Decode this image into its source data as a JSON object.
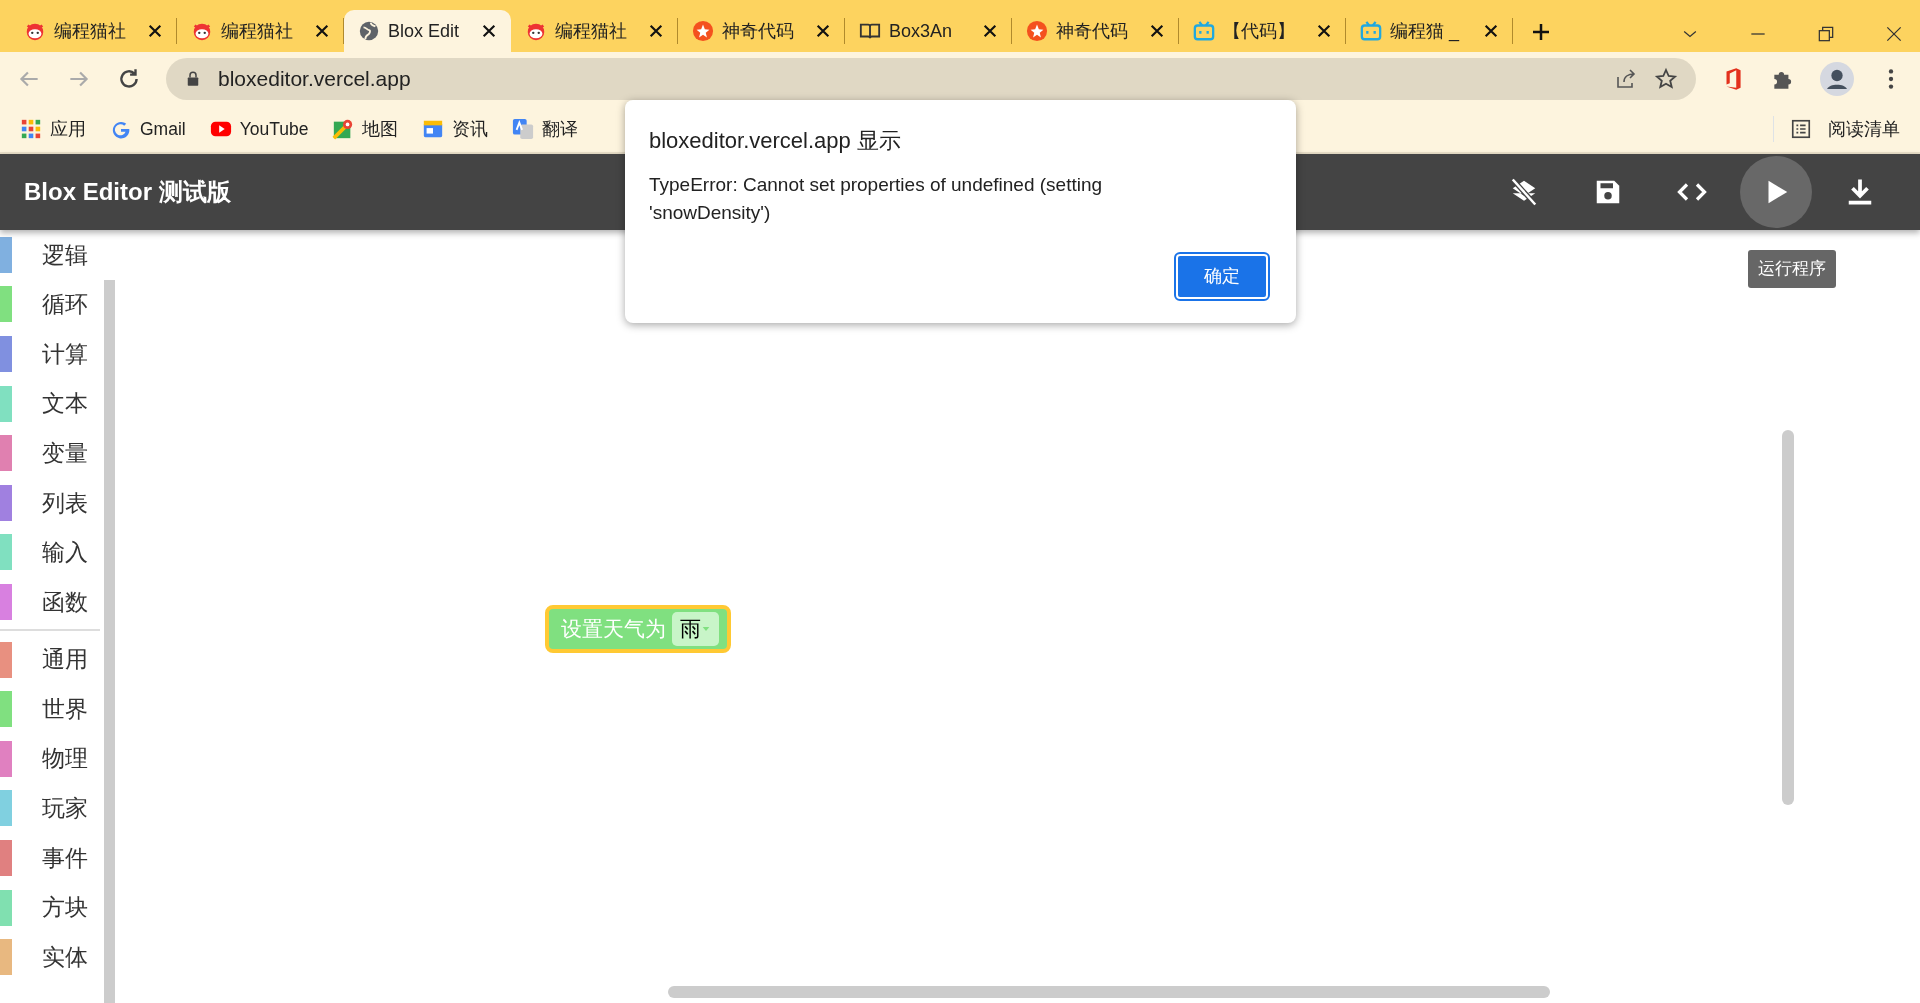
{
  "browser": {
    "tabs": [
      {
        "kind": "cat",
        "title": "编程猫社",
        "selected": false
      },
      {
        "kind": "cat",
        "title": "编程猫社",
        "selected": false
      },
      {
        "kind": "globe",
        "title": "Blox Edit",
        "selected": true
      },
      {
        "kind": "cat",
        "title": "编程猫社",
        "selected": false
      },
      {
        "kind": "star",
        "title": "神奇代码",
        "selected": false
      },
      {
        "kind": "book",
        "title": "Box3An",
        "selected": false
      },
      {
        "kind": "star",
        "title": "神奇代码",
        "selected": false
      },
      {
        "kind": "tv",
        "title": "【代码】",
        "selected": false
      },
      {
        "kind": "tv",
        "title": "编程猫 _",
        "selected": false
      }
    ],
    "address": "bloxeditor.vercel.app",
    "bookmarks": [
      {
        "kind": "apps",
        "label": "应用"
      },
      {
        "kind": "gmail",
        "label": "Gmail"
      },
      {
        "kind": "youtube",
        "label": "YouTube"
      },
      {
        "kind": "maps",
        "label": "地图"
      },
      {
        "kind": "news",
        "label": "资讯"
      },
      {
        "kind": "translate",
        "label": "翻译"
      }
    ],
    "reading_list": "阅读清单"
  },
  "app": {
    "title": "Blox Editor 测试版",
    "toolbar": [
      {
        "kind": "layers-off",
        "hovered": false
      },
      {
        "kind": "save",
        "hovered": false
      },
      {
        "kind": "code",
        "hovered": false
      },
      {
        "kind": "play",
        "hovered": true
      },
      {
        "kind": "download",
        "hovered": false
      }
    ],
    "tooltip": "运行程序",
    "sidebar": {
      "groups": [
        {
          "items": [
            {
              "label": "逻辑",
              "color": "#80b0e0"
            },
            {
              "label": "循环",
              "color": "#80e080"
            },
            {
              "label": "计算",
              "color": "#8090e0"
            },
            {
              "label": "文本",
              "color": "#80e0c0"
            },
            {
              "label": "变量",
              "color": "#e080b0"
            },
            {
              "label": "列表",
              "color": "#a080e0"
            },
            {
              "label": "输入",
              "color": "#80e0c0"
            },
            {
              "label": "函数",
              "color": "#d880e0"
            }
          ]
        },
        {
          "items": [
            {
              "label": "通用",
              "color": "#e89080"
            },
            {
              "label": "世界",
              "color": "#80e080"
            },
            {
              "label": "物理",
              "color": "#e080c0"
            },
            {
              "label": "玩家",
              "color": "#80d0e0"
            },
            {
              "label": "事件",
              "color": "#e08080"
            },
            {
              "label": "方块",
              "color": "#80e0b0"
            },
            {
              "label": "实体",
              "color": "#e8b880"
            }
          ]
        }
      ]
    },
    "block": {
      "label": "设置天气为",
      "value": "雨",
      "selected": true
    }
  },
  "dialog": {
    "title": "bloxeditor.vercel.app 显示",
    "message": "TypeError: Cannot set properties of undefined (setting 'snowDensity')",
    "button": "确定"
  }
}
